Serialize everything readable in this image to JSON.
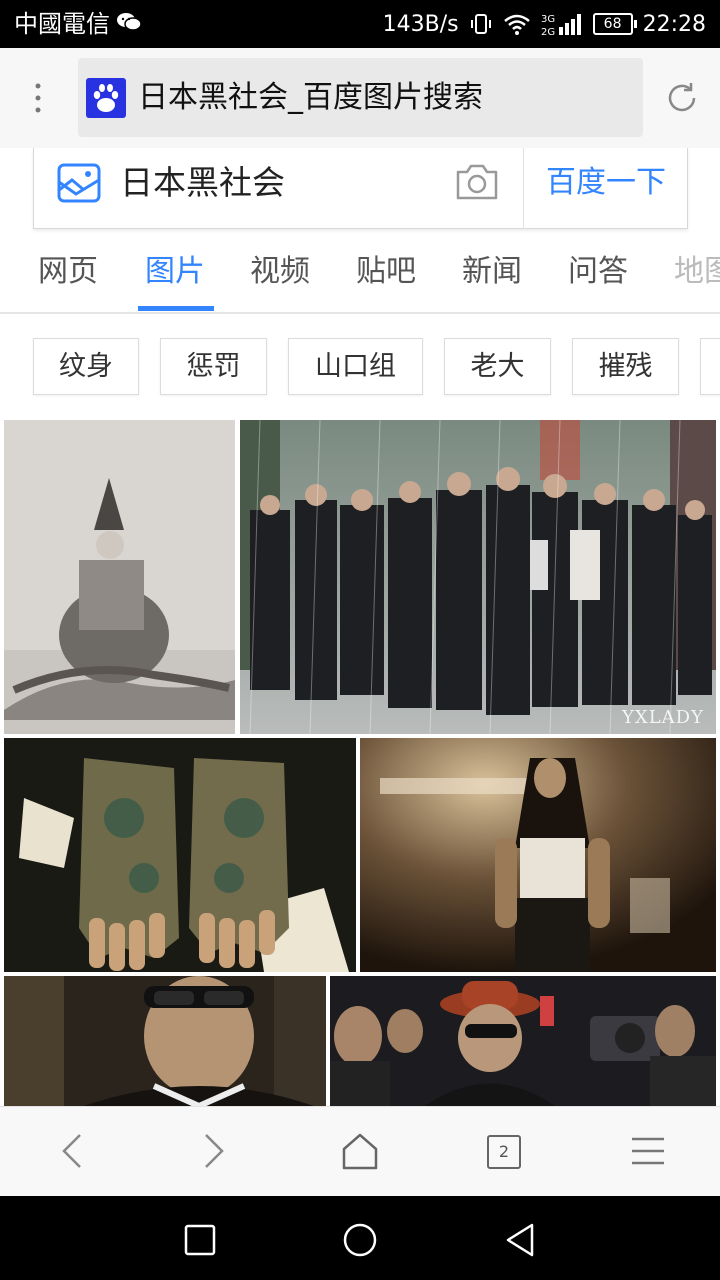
{
  "status_bar": {
    "carrier": "中國電信",
    "speed": "143B/s",
    "network": "3G 2G",
    "battery": "68",
    "time": "22:28"
  },
  "browser": {
    "page_title": "日本黑社会_百度图片搜索"
  },
  "search": {
    "query": "日本黑社会",
    "button": "百度一下"
  },
  "tabs": [
    "网页",
    "图片",
    "视频",
    "贴吧",
    "新闻",
    "问答",
    "地图"
  ],
  "active_tab": "图片",
  "chips": [
    "纹身",
    "惩罚",
    "山口组",
    "老大",
    "摧残"
  ],
  "images": {
    "watermark": "YXLADY"
  },
  "toolbar": {
    "tab_count": "2"
  },
  "icons": [
    "wechat-icon",
    "vibrate-icon",
    "wifi-icon",
    "signal-icon",
    "battery-icon",
    "more-dots-icon",
    "baidu-paw-icon",
    "refresh-icon",
    "image-icon",
    "camera-icon",
    "back-icon",
    "forward-icon",
    "home-icon",
    "menu-icon",
    "nav-square-icon",
    "nav-circle-icon",
    "nav-triangle-icon"
  ],
  "colors": {
    "accent": "#3385ff",
    "status_bar": "#000000",
    "nav_bar": "#000000"
  }
}
